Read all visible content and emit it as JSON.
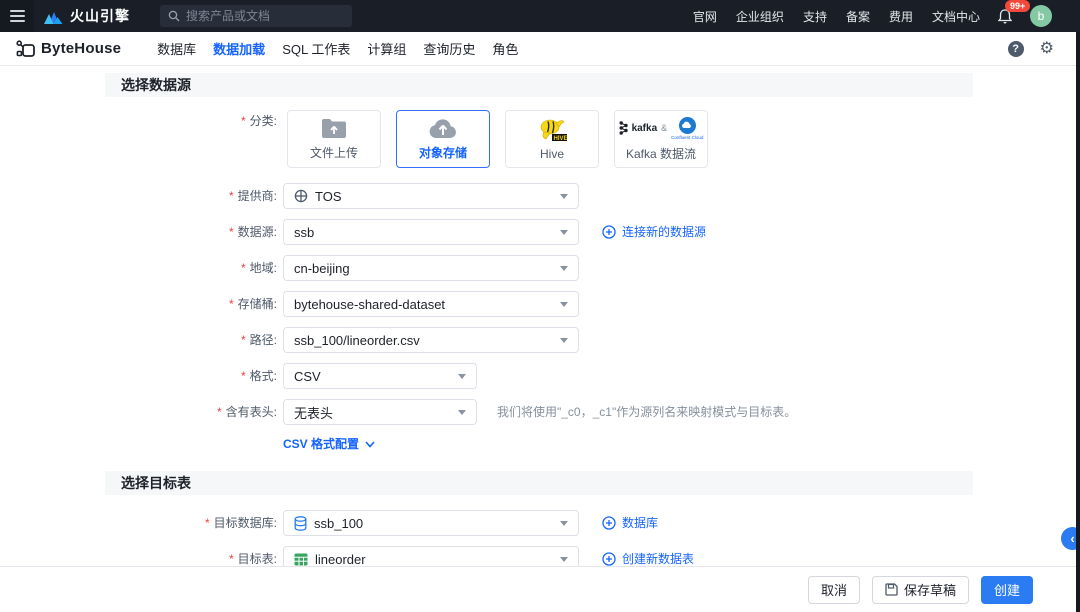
{
  "topbar": {
    "brand": "火山引擎",
    "search_placeholder": "搜索产品或文档",
    "links": [
      "官网",
      "企业组织",
      "支持",
      "备案",
      "费用",
      "文档中心"
    ],
    "notification_badge": "99+",
    "avatar_initial": "b"
  },
  "navbar": {
    "product": "ByteHouse",
    "tabs": [
      "数据库",
      "数据加载",
      "SQL 工作表",
      "计算组",
      "查询历史",
      "角色"
    ],
    "active_tab": "数据加载"
  },
  "source_section": {
    "title": "选择数据源",
    "category_label": "分类:",
    "cards": [
      {
        "label": "文件上传"
      },
      {
        "label": "对象存储",
        "selected": true
      },
      {
        "label": "Hive",
        "badge": "HIVE"
      },
      {
        "label": "Kafka 数据流",
        "kafka_text": "kafka",
        "amp": "&",
        "confluent_text": "Confluent Cloud"
      }
    ],
    "fields": [
      {
        "label": "提供商:",
        "value": "TOS"
      },
      {
        "label": "数据源:",
        "value": "ssb",
        "link": "连接新的数据源"
      },
      {
        "label": "地域:",
        "value": "cn-beijing"
      },
      {
        "label": "存储桶:",
        "value": "bytehouse-shared-dataset"
      },
      {
        "label": "路径:",
        "value": "ssb_100/lineorder.csv"
      },
      {
        "label": "格式:",
        "value": "CSV"
      },
      {
        "label": "含有表头:",
        "value": "无表头",
        "helper": "我们将使用\"_c0，_c1\"作为源列名来映射模式与目标表。"
      }
    ],
    "csv_config_link": "CSV 格式配置"
  },
  "target_section": {
    "title": "选择目标表",
    "fields": [
      {
        "label": "目标数据库:",
        "value": "ssb_100",
        "link": "数据库"
      },
      {
        "label": "目标表:",
        "value": "lineorder",
        "link": "创建新数据表"
      }
    ]
  },
  "footer": {
    "cancel": "取消",
    "save_draft": "保存草稿",
    "create": "创建"
  },
  "ui": {
    "required_marker": "*",
    "icons": {
      "gear": "⚙",
      "help": "?",
      "chevron_left": "‹"
    },
    "colors": {
      "accent_blue": "#1664ff",
      "button_blue": "#2b7cf2",
      "required_red": "#f53f3f",
      "badge_red": "#f5483b",
      "avatar_green": "#85c9a4",
      "topbar_dark": "#1a1f27",
      "section_bar_gray": "#f6f7f9"
    }
  }
}
